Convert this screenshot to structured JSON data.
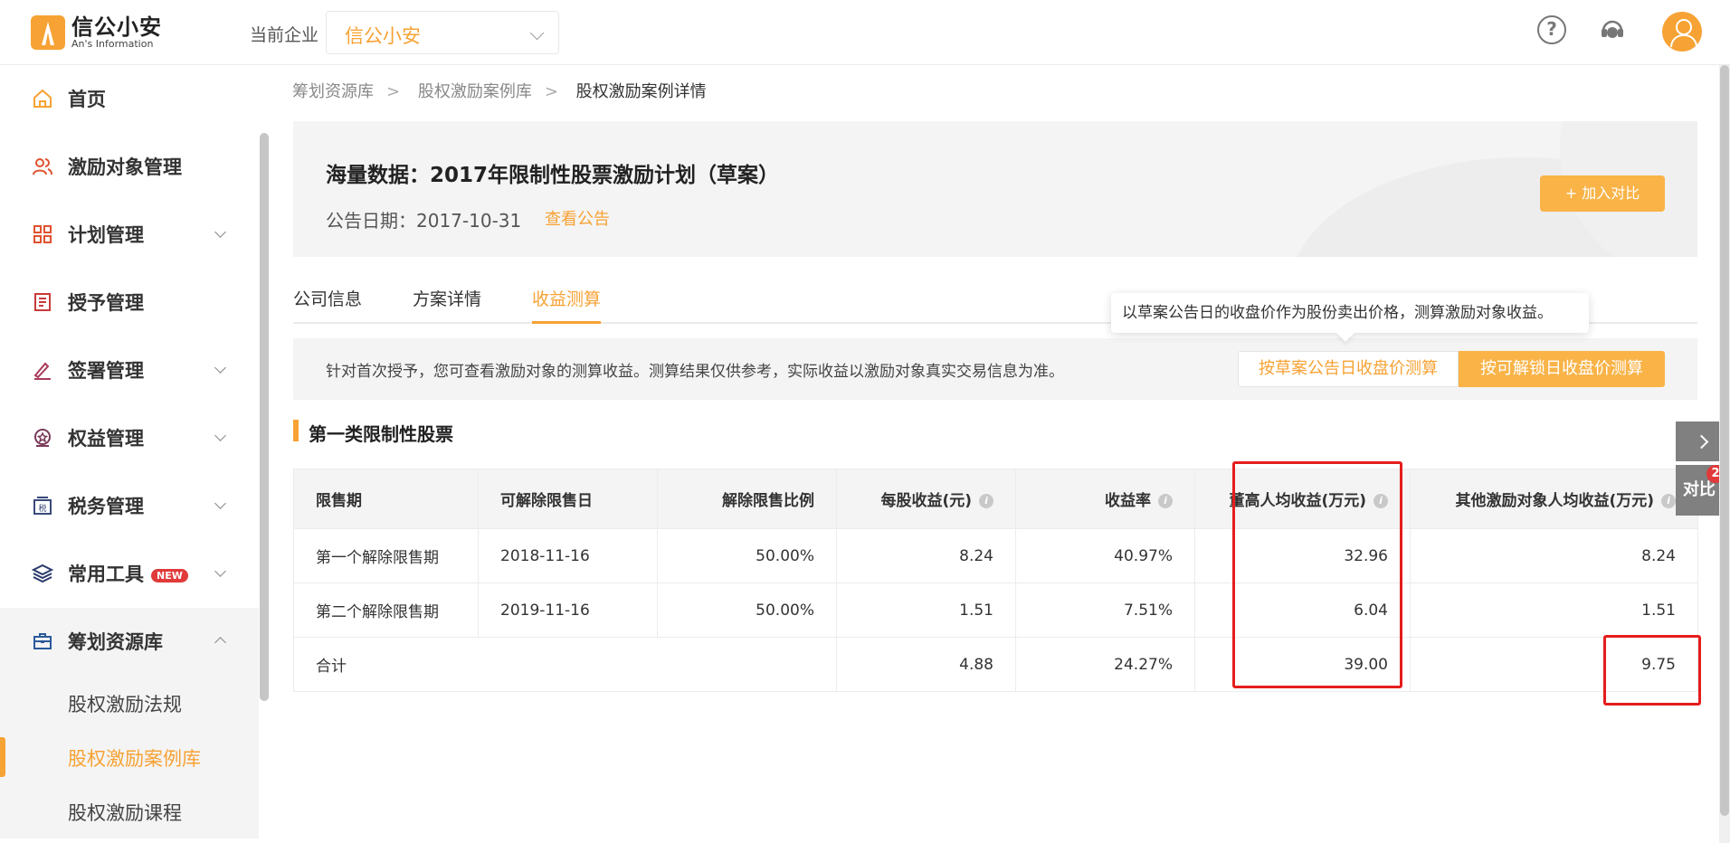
{
  "header": {
    "logo_cn": "信公小安",
    "logo_en": "An's Information",
    "enterprise_label": "当前企业",
    "enterprise_value": "信公小安"
  },
  "sidebar": {
    "items": [
      {
        "label": "首页",
        "icon": "home-icon"
      },
      {
        "label": "激励对象管理",
        "icon": "users-icon"
      },
      {
        "label": "计划管理",
        "icon": "grid-icon"
      },
      {
        "label": "授予管理",
        "icon": "document-icon"
      },
      {
        "label": "签署管理",
        "icon": "sign-icon"
      },
      {
        "label": "权益管理",
        "icon": "badge-icon"
      },
      {
        "label": "税务管理",
        "icon": "tax-icon"
      },
      {
        "label": "常用工具",
        "icon": "layers-icon",
        "badge": "NEW"
      },
      {
        "label": "筹划资源库",
        "icon": "toolbox-icon"
      }
    ],
    "sub_items": [
      {
        "label": "股权激励法规"
      },
      {
        "label": "股权激励案例库"
      },
      {
        "label": "股权激励课程"
      }
    ]
  },
  "breadcrumb": [
    "筹划资源库",
    "股权激励案例库",
    "股权激励案例详情"
  ],
  "hero": {
    "title": "海量数据：2017年限制性股票激励计划（草案）",
    "date": "公告日期：2017-10-31",
    "link": "查看公告",
    "add_compare": "+ 加入对比"
  },
  "tabs": [
    "公司信息",
    "方案详情",
    "收益测算"
  ],
  "tooltip": "以草案公告日的收盘价作为股份卖出价格，测算激励对象收益。",
  "notice": {
    "text": "针对首次授予，您可查看激励对象的测算收益。测算结果仅供参考，实际收益以激励对象真实交易信息为准。",
    "btn_draft": "按草案公告日收盘价测算",
    "btn_unlock": "按可解锁日收盘价测算"
  },
  "section_title": "第一类限制性股票",
  "table": {
    "headers": [
      "限售期",
      "可解除限售日",
      "解除限售比例",
      "每股收益(元)",
      "收益率",
      "董高人均收益(万元)",
      "其他激励对象人均收益(万元)"
    ],
    "rows": [
      [
        "第一个解除限售期",
        "2018-11-16",
        "50.00%",
        "8.24",
        "40.97%",
        "32.96",
        "8.24"
      ],
      [
        "第二个解除限售期",
        "2019-11-16",
        "50.00%",
        "1.51",
        "7.51%",
        "6.04",
        "1.51"
      ]
    ],
    "total": [
      "合计",
      "4.88",
      "24.27%",
      "39.00",
      "9.75"
    ]
  },
  "float": {
    "compare_label": "对比",
    "compare_count": "2"
  },
  "colors": {
    "accent": "#f7a234",
    "highlight": "#e51d1d"
  }
}
